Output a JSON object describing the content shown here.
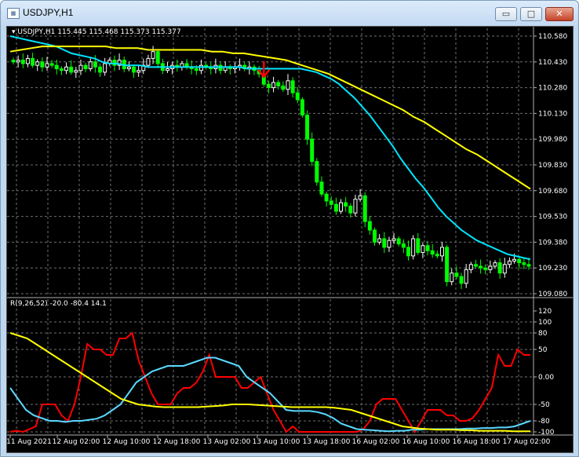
{
  "window": {
    "title": "USDJPY,H1",
    "icon_name": "chart-window-icon",
    "buttons": {
      "minimize": "▭",
      "maximize": "□",
      "close": "✕"
    }
  },
  "price_header": "USDJPY,H1  115.445 115.468 115.373 115.377",
  "indicator_header": "R(9,26,52) -20.0 -80.4 14.1",
  "price_axis": [
    "110.580",
    "110.430",
    "110.280",
    "110.130",
    "109.980",
    "109.830",
    "109.680",
    "109.530",
    "109.380",
    "109.230",
    "109.080"
  ],
  "indicator_axis": [
    "120",
    "100",
    "80",
    "50",
    "0.00",
    "-50",
    "-80",
    "-100"
  ],
  "time_axis": [
    "11 Aug 2021",
    "12 Aug 02:00",
    "12 Aug 10:00",
    "12 Aug 18:00",
    "13 Aug 02:00",
    "13 Aug 10:00",
    "13 Aug 18:00",
    "16 Aug 02:00",
    "16 Aug 10:00",
    "16 Aug 18:00",
    "17 Aug 02:00"
  ],
  "colors": {
    "background": "#000000",
    "grid": "#707070",
    "bull": "#ffffff",
    "bear": "#00ff00",
    "ma_fast": "#00e5ff",
    "ma_slow": "#ffff00",
    "osc_red": "#ff0000",
    "osc_cyan": "#5ad8ff",
    "osc_yellow": "#ffff00",
    "signal_arrow": "#ff0000"
  },
  "chart_data": [
    {
      "type": "candlestick",
      "symbol": "USDJPY",
      "timeframe": "H1",
      "ylim": [
        109.08,
        110.58
      ],
      "grid": true,
      "ohlc_header": {
        "open": 115.445,
        "high": 115.468,
        "low": 115.373,
        "close": 115.377
      },
      "closes": [
        110.43,
        110.44,
        110.42,
        110.45,
        110.41,
        110.43,
        110.4,
        110.42,
        110.41,
        110.39,
        110.38,
        110.4,
        110.37,
        110.38,
        110.41,
        110.39,
        110.43,
        110.4,
        110.37,
        110.42,
        110.44,
        110.41,
        110.44,
        110.39,
        110.4,
        110.37,
        110.38,
        110.41,
        110.45,
        110.49,
        110.42,
        110.38,
        110.39,
        110.41,
        110.4,
        110.42,
        110.4,
        110.39,
        110.38,
        110.41,
        110.4,
        110.39,
        110.41,
        110.38,
        110.4,
        110.39,
        110.4,
        110.41,
        110.39,
        110.4,
        110.38,
        110.36,
        110.3,
        110.28,
        110.31,
        110.29,
        110.27,
        110.32,
        110.25,
        110.21,
        110.12,
        109.98,
        109.85,
        109.73,
        109.66,
        109.62,
        109.6,
        109.56,
        109.61,
        109.59,
        109.55,
        109.63,
        109.65,
        109.5,
        109.45,
        109.38,
        109.4,
        109.35,
        109.39,
        109.4,
        109.37,
        109.35,
        109.3,
        109.4,
        109.32,
        109.36,
        109.33,
        109.31,
        109.3,
        109.35,
        109.15,
        109.2,
        109.18,
        109.14,
        109.22,
        109.25,
        109.24,
        109.23,
        109.22,
        109.24,
        109.26,
        109.2,
        109.25,
        109.27,
        109.28,
        109.26,
        109.25,
        109.24
      ],
      "series": [
        {
          "name": "MA fast",
          "color": "#00e5ff",
          "values": [
            110.58,
            110.57,
            110.56,
            110.55,
            110.54,
            110.53,
            110.52,
            110.5,
            110.48,
            110.47,
            110.46,
            110.45,
            110.43,
            110.42,
            110.42,
            110.41,
            110.41,
            110.41,
            110.4,
            110.4,
            110.4,
            110.4,
            110.4,
            110.4,
            110.4,
            110.4,
            110.4,
            110.4,
            110.4,
            110.4,
            110.4,
            110.39,
            110.39,
            110.39,
            110.39,
            110.39,
            110.39,
            110.39,
            110.39,
            110.38,
            110.37,
            110.35,
            110.33,
            110.3,
            110.26,
            110.22,
            110.17,
            110.12,
            110.06,
            110.0,
            109.94,
            109.87,
            109.81,
            109.75,
            109.7,
            109.64,
            109.58,
            109.53,
            109.49,
            109.45,
            109.42,
            109.39,
            109.37,
            109.35,
            109.33,
            109.31,
            109.3,
            109.29,
            109.28
          ]
        },
        {
          "name": "MA slow",
          "color": "#ffff00",
          "values": [
            110.49,
            110.5,
            110.51,
            110.52,
            110.52,
            110.52,
            110.52,
            110.52,
            110.52,
            110.52,
            110.51,
            110.51,
            110.51,
            110.5,
            110.5,
            110.5,
            110.5,
            110.5,
            110.5,
            110.49,
            110.49,
            110.48,
            110.48,
            110.47,
            110.46,
            110.45,
            110.44,
            110.42,
            110.4,
            110.38,
            110.36,
            110.33,
            110.3,
            110.27,
            110.24,
            110.21,
            110.18,
            110.15,
            110.11,
            110.08,
            110.04,
            110.0,
            109.96,
            109.92,
            109.89,
            109.85,
            109.81,
            109.77,
            109.73,
            109.69
          ]
        }
      ],
      "signal": {
        "type": "sell-arrow",
        "at_price": 110.37
      }
    },
    {
      "type": "line",
      "name": "R(9,26,52)",
      "values_header": [
        -20.0,
        -80.4,
        14.1
      ],
      "ylim": [
        -100,
        120
      ],
      "levels": [
        100,
        80,
        50,
        0,
        -50,
        -80,
        -100
      ],
      "series": [
        {
          "name": "line 1",
          "color": "#ff0000",
          "values": [
            -100,
            -98,
            -100,
            -95,
            -90,
            -50,
            -50,
            -50,
            -70,
            -80,
            -50,
            0,
            60,
            50,
            50,
            40,
            40,
            70,
            70,
            80,
            30,
            0,
            -30,
            -50,
            -50,
            -50,
            -30,
            -20,
            -20,
            -10,
            10,
            40,
            0,
            0,
            0,
            0,
            -20,
            -20,
            -10,
            0,
            -30,
            -60,
            -80,
            -100,
            -90,
            -100,
            -100,
            -100,
            -100,
            -100,
            -100,
            -100,
            -100,
            -100,
            -100,
            -95,
            -80,
            -50,
            -40,
            -40,
            -40,
            -60,
            -80,
            -100,
            -80,
            -60,
            -60,
            -60,
            -70,
            -70,
            -80,
            -80,
            -75,
            -60,
            -40,
            -20,
            40,
            20,
            20,
            50,
            40,
            40
          ]
        },
        {
          "name": "line 2",
          "color": "#5ad8ff",
          "values": [
            -20,
            -40,
            -60,
            -70,
            -75,
            -80,
            -80,
            -82,
            -80,
            -80,
            -78,
            -76,
            -70,
            -60,
            -50,
            -30,
            -10,
            0,
            10,
            15,
            20,
            20,
            20,
            25,
            30,
            35,
            35,
            30,
            25,
            20,
            0,
            -10,
            -20,
            -30,
            -45,
            -60,
            -62,
            -62,
            -62,
            -64,
            -68,
            -75,
            -85,
            -90,
            -95,
            -96,
            -97,
            -98,
            -99,
            -98,
            -98,
            -96,
            -96,
            -95,
            -95,
            -95,
            -95,
            -95,
            -94,
            -94,
            -93,
            -93,
            -92,
            -92,
            -90,
            -85,
            -80
          ]
        },
        {
          "name": "line 3",
          "color": "#ffff00",
          "values": [
            80,
            75,
            70,
            60,
            50,
            40,
            30,
            20,
            10,
            0,
            -10,
            -20,
            -30,
            -40,
            -45,
            -50,
            -52,
            -54,
            -55,
            -55,
            -55,
            -55,
            -55,
            -54,
            -53,
            -52,
            -50,
            -50,
            -50,
            -51,
            -52,
            -53,
            -54,
            -55,
            -55,
            -55,
            -55,
            -55,
            -56,
            -58,
            -60,
            -65,
            -70,
            -75,
            -80,
            -85,
            -90,
            -92,
            -94,
            -95,
            -96,
            -96,
            -96,
            -97,
            -97,
            -98,
            -98,
            -98,
            -98,
            -99,
            -99,
            -99
          ]
        }
      ]
    }
  ]
}
